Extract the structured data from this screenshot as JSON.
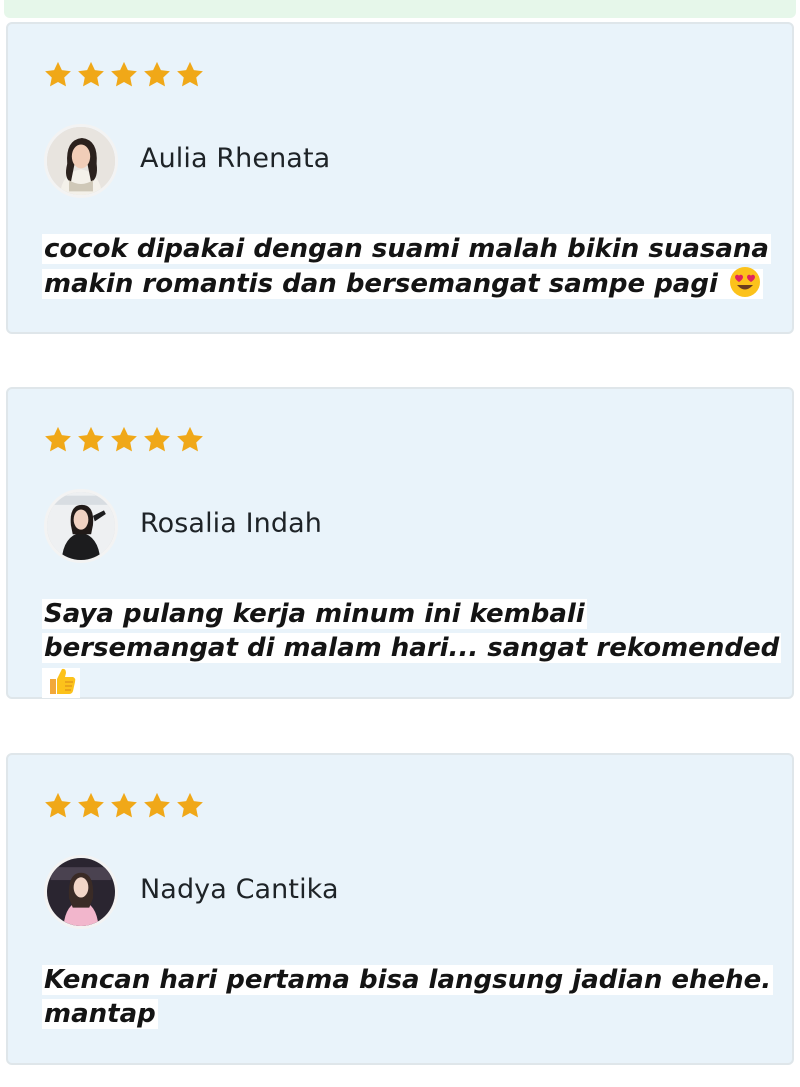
{
  "colors": {
    "card_background": "#e9f3fa",
    "star": "#f0a818",
    "text": "#141414",
    "name": "#1e2327",
    "top_strip": "#e6f7ea"
  },
  "reviews": [
    {
      "rating": 5,
      "name": "Aulia Rhenata",
      "text": "cocok dipakai dengan suami malah bikin suasana makin romantis dan bersemangat sampe pagi",
      "emoji": "heart-eyes-emoji"
    },
    {
      "rating": 5,
      "name": "Rosalia Indah",
      "text": "Saya pulang kerja minum ini kembali bersemangat di malam hari... sangat rekomended",
      "emoji": "thumbs-up-emoji"
    },
    {
      "rating": 5,
      "name": "Nadya Cantika",
      "text": "Kencan hari pertama bisa langsung jadian ehehe. mantap",
      "emoji": ""
    }
  ]
}
